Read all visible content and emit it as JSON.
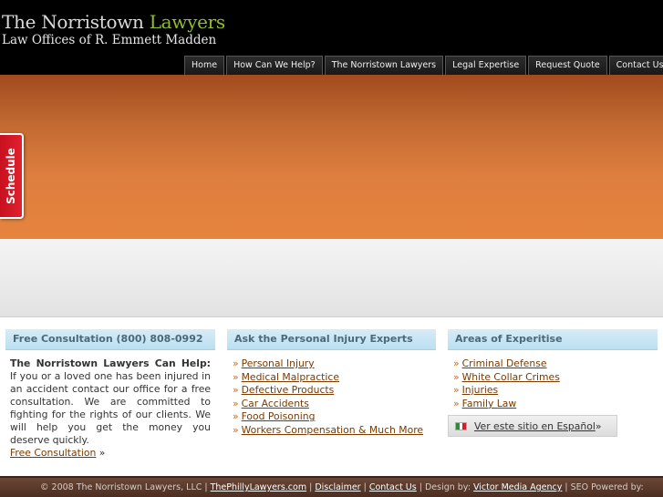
{
  "header": {
    "logo_title_part1": "The Norristown ",
    "logo_title_part2": "Lawyers",
    "logo_subtitle": "Law Offices of R. Emmett Madden"
  },
  "nav": [
    "Home",
    "How Can We Help?",
    "The Norristown Lawyers",
    "Legal Expertise",
    "Request Quote",
    "Contact Us"
  ],
  "schedule_label": "Schedule",
  "columns": {
    "consultation": {
      "heading": "Free Consultation (800) 808-0992",
      "intro_bold": "The Norristown Lawyers Can Help:",
      "intro_text": " If you or a loved one has been injured in an accident contact our office for a free consultation. We are committed to fighting for the rights of our clients. We will help you get the money you deserve quickly.",
      "link": "Free Consultation",
      "link_suffix": " »"
    },
    "experts": {
      "heading": "Ask the Personal Injury Experts",
      "items": [
        "Personal Injury",
        "Medical Malpractice",
        "Defective Products",
        "Car Accidents",
        "Food Poisoning",
        "Workers Compensation & Much More"
      ]
    },
    "areas": {
      "heading": "Areas of Experitise",
      "items": [
        "Criminal Defense",
        "White Collar Crimes",
        "Injuries",
        "Family Law"
      ],
      "spanish_link": "Ver este sitio en Español",
      "spanish_suffix": " »"
    }
  },
  "bullet": "»",
  "footer": {
    "copyright": "© 2008 The Norristown Lawyers, LLC | ",
    "link1": "ThePhillyLawyers.com",
    "sep1": " | ",
    "link2": "Disclaimer",
    "sep2": " | ",
    "link3": "Contact Us",
    "design_text": " | Design by: ",
    "link4": "Victor Media Agency",
    "seo_text": " | SEO Powered by:"
  },
  "colors": {
    "accent_green": "#8fbf2f",
    "link_brown": "#7a3a00",
    "banner_orange": "#e6843e",
    "heading_blue": "#bcdff0",
    "schedule_red": "#d9182a"
  }
}
